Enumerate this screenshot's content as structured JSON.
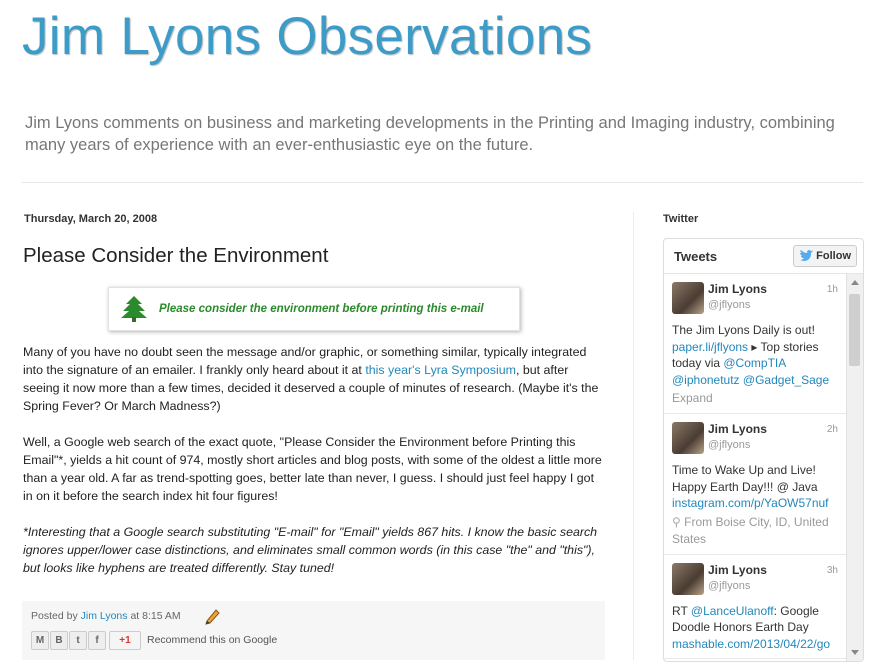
{
  "header": {
    "title": "Jim Lyons Observations",
    "description": "Jim Lyons comments on business and marketing developments in the Printing and Imaging industry, combining many years of experience with an ever-enthusiastic eye on the future."
  },
  "post": {
    "date": "Thursday, March 20, 2008",
    "title": "Please Consider the Environment",
    "banner_text": "Please consider the environment before printing this e-mail",
    "p1_a": "Many of you have no doubt seen the message and/or graphic, or something similar, typically integrated into the signature of an emailer. I frankly only heard about it at ",
    "p1_link": "this year's Lyra Symposium",
    "p1_b": ", but after seeing it now more than a few times, decided it deserved a couple of minutes of research. (Maybe it's the Spring Fever? Or March Madness?)",
    "p2": "Well, a Google web search of the exact quote, \"Please Consider the Environment before Printing this Email\"*, yields a hit count of 974, mostly short articles and blog posts, with some of the oldest a little more than a year old. A far as trend-spotting goes, better late than never, I guess. I should just feel happy I got in on it before the search index hit four figures!",
    "p3": "*Interesting that a Google search substituting \"E-mail\" for \"Email\" yields 867 hits. I know the basic search ignores upper/lower case distinctions, and eliminates small common words (in this case \"the\" and \"this\"), but looks like hyphens are treated differently. Stay tuned!",
    "posted_by": "Posted by",
    "author": "Jim Lyons",
    "at": "at",
    "time": "8:15 AM",
    "share": {
      "email": "M",
      "blog": "B",
      "twitter": "t",
      "facebook": "f",
      "gplus": "+1"
    },
    "recommend": "Recommend this on Google"
  },
  "sidebar": {
    "title": "Twitter",
    "widget_title": "Tweets",
    "follow_label": "Follow",
    "tweets": [
      {
        "name": "Jim Lyons",
        "handle": "@jflyons",
        "time": "1h",
        "text_a": "The Jim Lyons Daily is out! ",
        "link1": "paper.li/jflyons",
        "text_b": " ▸ Top stories today via ",
        "link2": "@CompTIA",
        "text_c": " ",
        "link3": "@iphonetutz",
        "text_d": " ",
        "link4": "@Gadget_Sage",
        "meta": "Expand"
      },
      {
        "name": "Jim Lyons",
        "handle": "@jflyons",
        "time": "2h",
        "text_a": "Time to Wake Up and Live! Happy Earth Day!!! @ Java ",
        "link1": "instagram.com/p/YaOW57nuf",
        "meta": "From Boise City, ID, United States"
      },
      {
        "name": "Jim Lyons",
        "handle": "@jflyons",
        "time": "3h",
        "text_a": "RT ",
        "link1": "@LanceUlanoff",
        "text_b": ": Google Doodle Honors Earth Day ",
        "link2": "mashable.com/2013/04/22/go"
      }
    ]
  },
  "colors": {
    "title": "#3d9cc7",
    "link": "#2288bb",
    "banner_green": "#2b8a2b"
  }
}
